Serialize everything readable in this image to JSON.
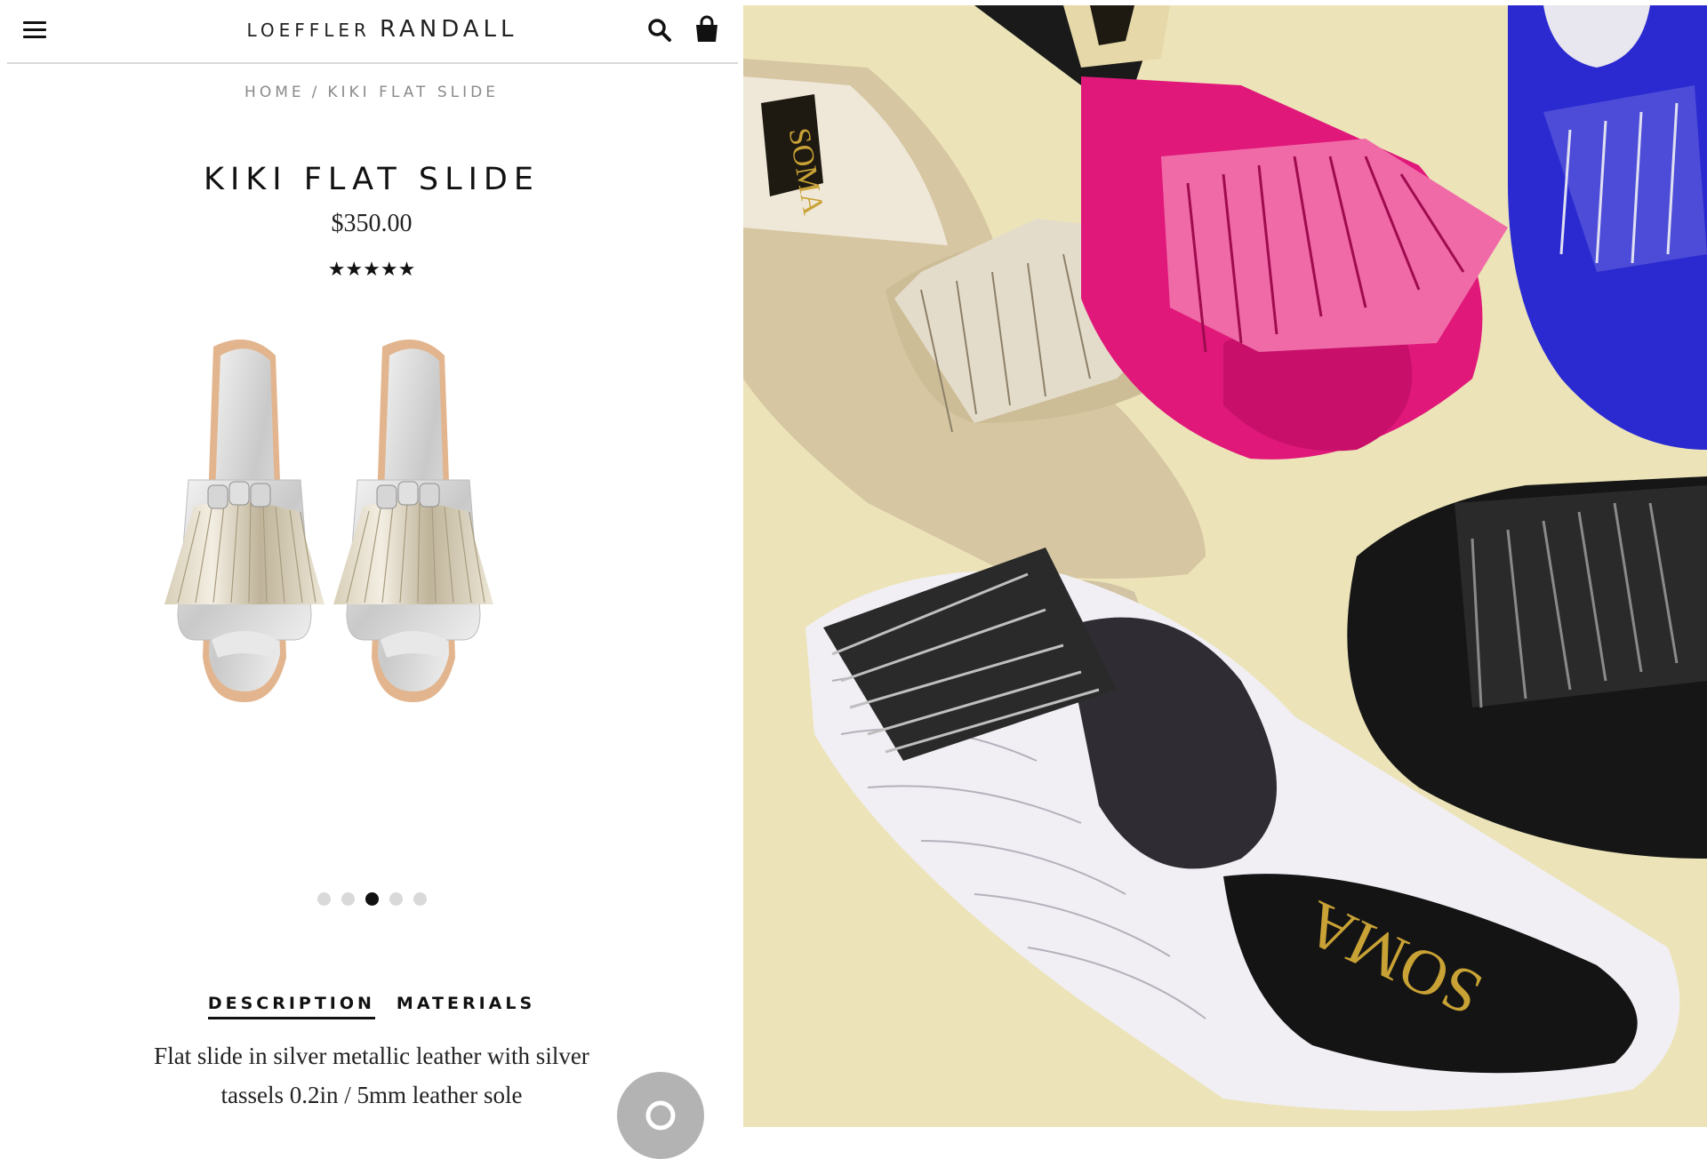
{
  "header": {
    "brand_first": "LOEFFLER",
    "brand_second": "RANDALL",
    "menu_icon": "hamburger-icon",
    "search_icon": "search-icon",
    "bag_icon": "shopping-bag-icon"
  },
  "breadcrumb": {
    "home": "HOME",
    "separator": "/",
    "current": "KIKI FLAT SLIDE"
  },
  "product": {
    "title": "KIKI FLAT SLIDE",
    "price": "$350.00",
    "rating_stars": "★★★★★",
    "rating_value": 5,
    "image_count": 5,
    "active_image": 3
  },
  "tabs": [
    {
      "label": "DESCRIPTION",
      "active": true
    },
    {
      "label": "MATERIALS",
      "active": false
    }
  ],
  "description": {
    "line1": "Flat slide in silver metallic leather with silver",
    "line2": "tassels 0.2in / 5mm leather sole"
  },
  "photo": {
    "insole_brand": "SOMA",
    "background_color": "#ece4b8",
    "shoe_colors": [
      "#d9c9a6",
      "#e0187a",
      "#2a2ad0",
      "#f1eef4",
      "#1a1a1a"
    ]
  }
}
